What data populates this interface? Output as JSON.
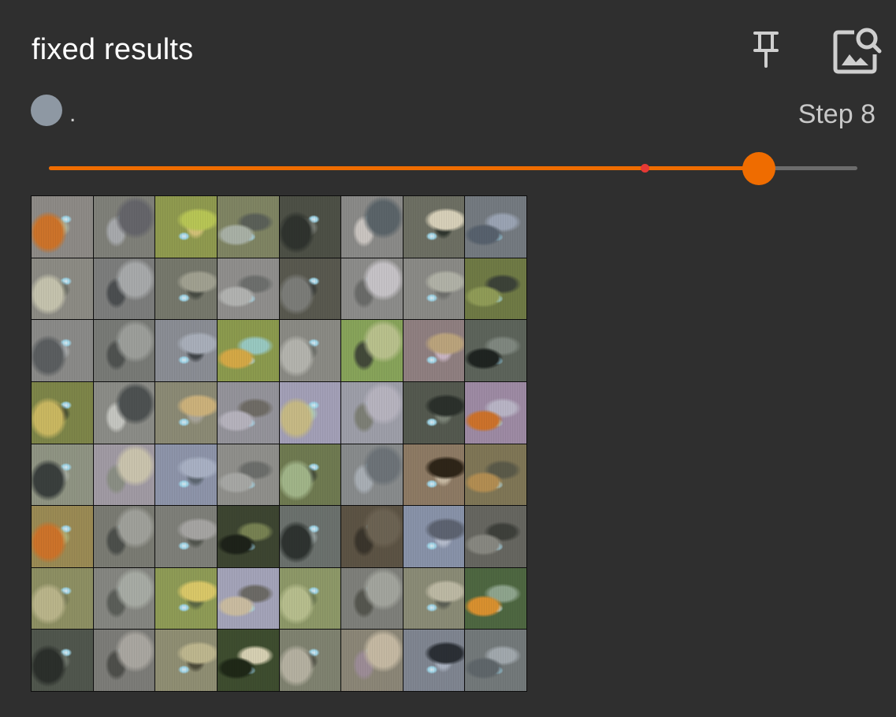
{
  "card": {
    "title": "fixed results",
    "pin_icon": "pin-icon",
    "image_search_icon": "image-search-icon"
  },
  "run": {
    "name": ".",
    "color": "#8e98a3"
  },
  "step": {
    "label": "Step 8",
    "value": 8
  },
  "slider": {
    "accent": "#ef6c00",
    "marker_color": "#e53935",
    "value_fraction": 0.878,
    "marker_fraction": 0.737
  },
  "image": {
    "description_rows": 8,
    "description_cols": 8
  },
  "tiles": [
    {
      "base": "#8d8a86",
      "b1": "#c8742e",
      "b2": "#b9c2a8"
    },
    {
      "base": "#7f8079",
      "b1": "#65656a",
      "b2": "#a7a9ac"
    },
    {
      "base": "#8f9a4f",
      "b1": "#b7c45a",
      "b2": "#d0c07a"
    },
    {
      "base": "#7f8463",
      "b1": "#a8b0a5",
      "b2": "#5b6058"
    },
    {
      "base": "#4d5046",
      "b1": "#2f332e",
      "b2": "#8b8f88"
    },
    {
      "base": "#8a8a88",
      "b1": "#5b6469",
      "b2": "#c9c4c0"
    },
    {
      "base": "#6d6f63",
      "b1": "#d6cfb9",
      "b2": "#30362f"
    },
    {
      "base": "#747a80",
      "b1": "#57616c",
      "b2": "#9aa3b2"
    },
    {
      "base": "#8c8b84",
      "b1": "#c4c2ae",
      "b2": "#5d6058"
    },
    {
      "base": "#7c7d7c",
      "b1": "#a7a9aa",
      "b2": "#4b4e50"
    },
    {
      "base": "#76786c",
      "b1": "#a0a091",
      "b2": "#484c44"
    },
    {
      "base": "#8f8e8c",
      "b1": "#b1b2b0",
      "b2": "#6d6f6d"
    },
    {
      "base": "#59594f",
      "b1": "#7b7c78",
      "b2": "#2f3230"
    },
    {
      "base": "#8c8c8a",
      "b1": "#c5c2c6",
      "b2": "#6a6b69"
    },
    {
      "base": "#8a8a86",
      "b1": "#b0b1a6",
      "b2": "#6f706d"
    },
    {
      "base": "#6f7a45",
      "b1": "#8f9b5a",
      "b2": "#3c4238"
    },
    {
      "base": "#8a8a88",
      "b1": "#5b5e60",
      "b2": "#b5b8bb"
    },
    {
      "base": "#787a76",
      "b1": "#9c9e9a",
      "b2": "#4f5250"
    },
    {
      "base": "#8a8d94",
      "b1": "#a8aeb8",
      "b2": "#42464a"
    },
    {
      "base": "#8b9a4e",
      "b1": "#d2a84b",
      "b2": "#9ac7c0"
    },
    {
      "base": "#8a8a84",
      "b1": "#b3b3ad",
      "b2": "#5d605b"
    },
    {
      "base": "#87a35a",
      "b1": "#b8c08e",
      "b2": "#42493a"
    },
    {
      "base": "#8f7f80",
      "b1": "#b9a37e",
      "b2": "#c7b4c2"
    },
    {
      "base": "#5d645b",
      "b1": "#1f2421",
      "b2": "#7f877f"
    },
    {
      "base": "#7d8549",
      "b1": "#c8b765",
      "b2": "#2f3528"
    },
    {
      "base": "#8b8c87",
      "b1": "#4d5151",
      "b2": "#c4c5c0"
    },
    {
      "base": "#8b8a75",
      "b1": "#cab17e",
      "b2": "#a7a49a"
    },
    {
      "base": "#94939a",
      "b1": "#b5b2bc",
      "b2": "#6f6c66"
    },
    {
      "base": "#a29fb6",
      "b1": "#c5b987",
      "b2": "#b1d3be"
    },
    {
      "base": "#9d9ea8",
      "b1": "#b6b3be",
      "b2": "#7d7f76"
    },
    {
      "base": "#54594f",
      "b1": "#2b302b",
      "b2": "#7b8277"
    },
    {
      "base": "#9d8aa3",
      "b1": "#c8732f",
      "b2": "#b8b4c4"
    },
    {
      "base": "#8f9483",
      "b1": "#3a3f3d",
      "b2": "#b2b7ad"
    },
    {
      "base": "#a09aa3",
      "b1": "#c9c3ae",
      "b2": "#8a8e84"
    },
    {
      "base": "#8d94a9",
      "b1": "#a8b0c2",
      "b2": "#5d6670"
    },
    {
      "base": "#8f8f8b",
      "b1": "#a6a7a4",
      "b2": "#6c6e6b"
    },
    {
      "base": "#6f7a51",
      "b1": "#a1b48a",
      "b2": "#2f342c"
    },
    {
      "base": "#888b8c",
      "b1": "#6d7378",
      "b2": "#a8aeb4"
    },
    {
      "base": "#8d7a64",
      "b1": "#2e2519",
      "b2": "#c4b7a2"
    },
    {
      "base": "#7f7656",
      "b1": "#b08d55",
      "b2": "#5b5a4a"
    },
    {
      "base": "#9a8a54",
      "b1": "#c8742e",
      "b2": "#b6c08a"
    },
    {
      "base": "#7a7b73",
      "b1": "#9fa09a",
      "b2": "#4c4f4b"
    },
    {
      "base": "#7e7f79",
      "b1": "#a5a4a2",
      "b2": "#53564f"
    },
    {
      "base": "#3d4531",
      "b1": "#1d2219",
      "b2": "#778154"
    },
    {
      "base": "#6b716d",
      "b1": "#2e3330",
      "b2": "#a8b3b2"
    },
    {
      "base": "#5c5344",
      "b1": "#6c6354",
      "b2": "#3a352c"
    },
    {
      "base": "#8892a8",
      "b1": "#5d6370",
      "b2": "#b4bbca"
    },
    {
      "base": "#666660",
      "b1": "#878780",
      "b2": "#3e403b"
    },
    {
      "base": "#8d8f63",
      "b1": "#b9b48c",
      "b2": "#6f7353"
    },
    {
      "base": "#858681",
      "b1": "#a7aba4",
      "b2": "#5b5e59"
    },
    {
      "base": "#8e9b56",
      "b1": "#d8c76c",
      "b2": "#5c6846"
    },
    {
      "base": "#a3a3b8",
      "b1": "#c8bba1",
      "b2": "#6c6a66"
    },
    {
      "base": "#8d9868",
      "b1": "#b6bd8f",
      "b2": "#5e6a4a"
    },
    {
      "base": "#7e7f7a",
      "b1": "#a2a49d",
      "b2": "#55564f"
    },
    {
      "base": "#8a8b76",
      "b1": "#bcb8a4",
      "b2": "#5d6056"
    },
    {
      "base": "#4e6741",
      "b1": "#d59034",
      "b2": "#8fa48e"
    },
    {
      "base": "#50564d",
      "b1": "#2b2f2b",
      "b2": "#7d847a"
    },
    {
      "base": "#7c7c78",
      "b1": "#a9a6a0",
      "b2": "#4e4f4b"
    },
    {
      "base": "#8f8e73",
      "b1": "#bdb690",
      "b2": "#4d4b3b"
    },
    {
      "base": "#3e4d2f",
      "b1": "#1f2818",
      "b2": "#d5cfb3"
    },
    {
      "base": "#7f8270",
      "b1": "#b4b0a1",
      "b2": "#3f3f36"
    },
    {
      "base": "#8b8677",
      "b1": "#c3b8a3",
      "b2": "#9b8c96"
    },
    {
      "base": "#7f8590",
      "b1": "#2b2f35",
      "b2": "#a9b1bf"
    },
    {
      "base": "#73797a",
      "b1": "#5f666a",
      "b2": "#a1a8ad"
    }
  ]
}
